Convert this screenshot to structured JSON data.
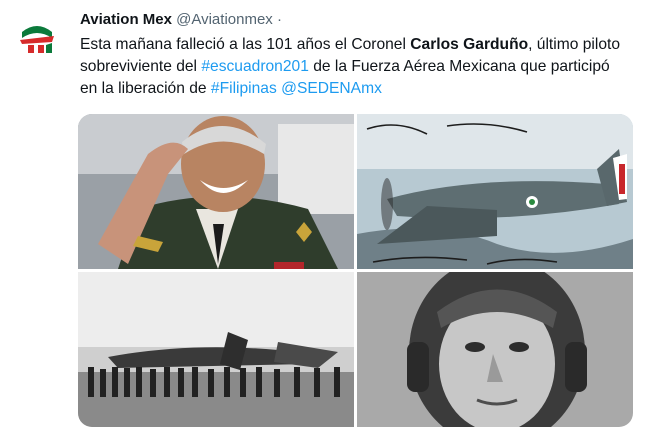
{
  "tweet": {
    "author_name": "Aviation Mex",
    "author_handle": "@Aviationmex",
    "separator": "·",
    "text": {
      "part1": "Esta mañana falleció a las 101 años el Coronel ",
      "bold": "Carlos Garduño",
      "part2": ", último piloto sobreviviente del ",
      "hashtag1": "#escuadron201",
      "part3": " de la Fuerza Aérea Mexicana que participó en la liberación de ",
      "hashtag2": "#Filipinas",
      "space": " ",
      "mention": "@SEDENAmx"
    },
    "avatar_icon": "aviation-mex-logo-icon",
    "photos": [
      {
        "name": "photo-colonel-saluting",
        "icon": "saluting-veteran-photo"
      },
      {
        "name": "photo-p47-painting-signed",
        "icon": "p47-aircraft-painting"
      },
      {
        "name": "photo-squadron-on-airfield",
        "icon": "squadron-lineup-photo"
      },
      {
        "name": "photo-young-pilot-portrait",
        "icon": "pilot-portrait-photo"
      }
    ],
    "colors": {
      "link": "#1d9bf0",
      "muted": "#536471",
      "text": "#0f1419"
    }
  }
}
